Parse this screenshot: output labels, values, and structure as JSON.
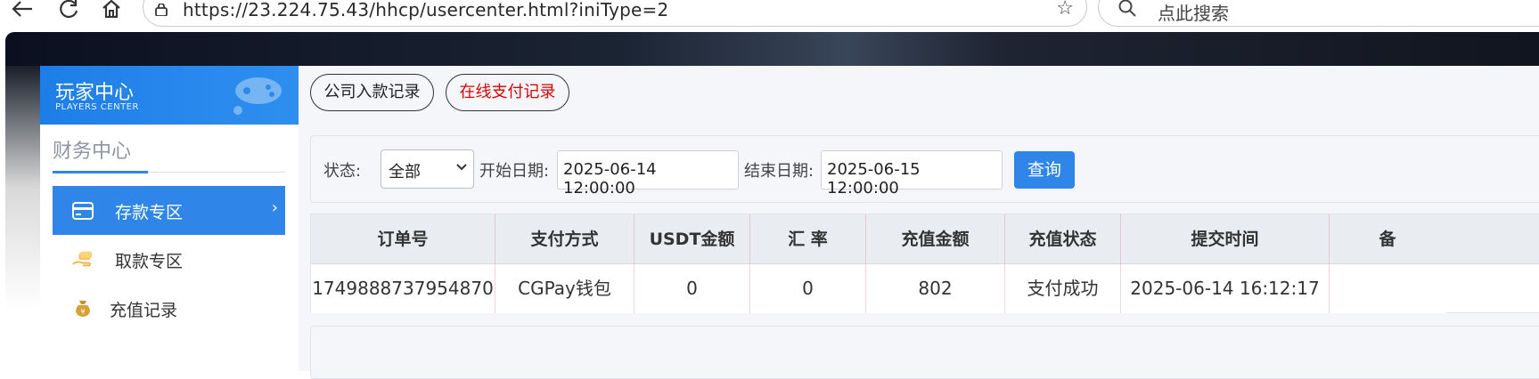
{
  "browser": {
    "url": "https://23.224.75.43/hhcp/usercenter.html?iniType=2",
    "search_placeholder": "点此搜索"
  },
  "sidebar": {
    "title": "玩家中心",
    "subtitle": "PLAYERS CENTER",
    "section_title": "财务中心",
    "items": [
      {
        "label": "存款专区",
        "icon": "card-icon",
        "active": true
      },
      {
        "label": "取款专区",
        "icon": "hand-money-icon",
        "active": false
      },
      {
        "label": "充值记录",
        "icon": "money-bag-icon",
        "active": false
      }
    ]
  },
  "tabs": [
    {
      "label": "公司入款记录"
    },
    {
      "label": "在线支付记录"
    }
  ],
  "filter": {
    "status_label": "状态:",
    "status_value": "全部",
    "start_label": "开始日期:",
    "start_value": "2025-06-14 12:00:00",
    "end_label": "结束日期:",
    "end_value": "2025-06-15 12:00:00",
    "query_label": "查询"
  },
  "table": {
    "headers": [
      "订单号",
      "支付方式",
      "USDT金额",
      "汇 率",
      "充值金额",
      "充值状态",
      "提交时间",
      "备"
    ],
    "rows": [
      [
        "1749888737954870",
        "CGPay钱包",
        "0",
        "0",
        "802",
        "支付成功",
        "2025-06-14 16:12:17",
        ""
      ]
    ]
  },
  "colors": {
    "accent": "#2f86e8",
    "active_tab_text": "#e00000"
  }
}
